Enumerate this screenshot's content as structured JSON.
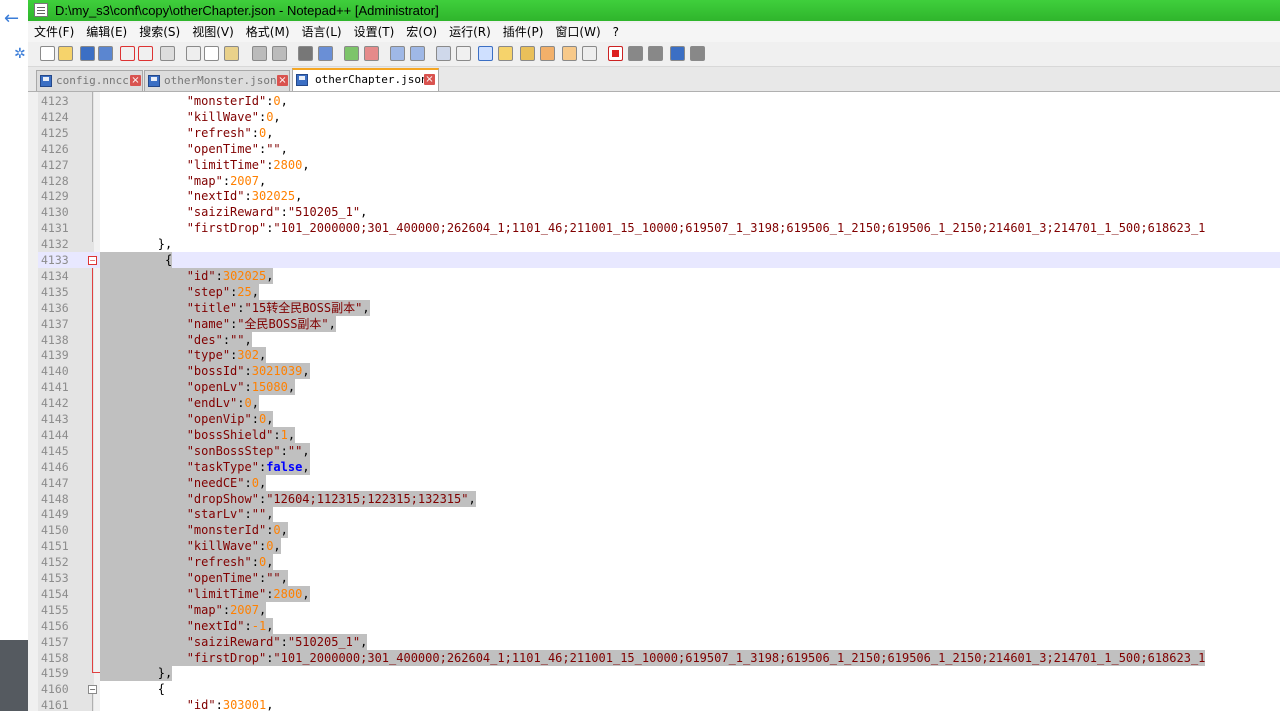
{
  "window": {
    "title": "D:\\my_s3\\conf\\copy\\otherChapter.json - Notepad++ [Administrator]"
  },
  "menu": [
    "文件(F)",
    "编辑(E)",
    "搜索(S)",
    "视图(V)",
    "格式(M)",
    "语言(L)",
    "设置(T)",
    "宏(O)",
    "运行(R)",
    "插件(P)",
    "窗口(W)",
    "?"
  ],
  "tabs": [
    {
      "label": "config.nncc",
      "active": false
    },
    {
      "label": "otherMonster.json",
      "active": false
    },
    {
      "label": "otherChapter.json",
      "active": true
    }
  ],
  "colors": {
    "titlebar": "#2fb52c",
    "selection": "#c0c0c0",
    "key": "#800000",
    "number": "#ff8000",
    "keyword": "#0000ff",
    "fold": "#e04040"
  },
  "lines": [
    {
      "num": "4123",
      "ind": "            ",
      "k": "\"monsterId\"",
      "v": "0",
      "t": "n",
      "end": ","
    },
    {
      "num": "4124",
      "ind": "            ",
      "k": "\"killWave\"",
      "v": "0",
      "t": "n",
      "end": ","
    },
    {
      "num": "4125",
      "ind": "            ",
      "k": "\"refresh\"",
      "v": "0",
      "t": "n",
      "end": ","
    },
    {
      "num": "4126",
      "ind": "            ",
      "k": "\"openTime\"",
      "v": "\"\"",
      "t": "s",
      "end": ","
    },
    {
      "num": "4127",
      "ind": "            ",
      "k": "\"limitTime\"",
      "v": "2800",
      "t": "n",
      "end": ","
    },
    {
      "num": "4128",
      "ind": "            ",
      "k": "\"map\"",
      "v": "2007",
      "t": "n",
      "end": ","
    },
    {
      "num": "4129",
      "ind": "            ",
      "k": "\"nextId\"",
      "v": "302025",
      "t": "n",
      "end": ","
    },
    {
      "num": "4130",
      "ind": "            ",
      "k": "\"saiziReward\"",
      "v": "\"510205_1\"",
      "t": "s",
      "end": ","
    },
    {
      "num": "4131",
      "ind": "            ",
      "k": "\"firstDrop\"",
      "v": "\"101_2000000;301_400000;262604_1;1101_46;211001_15_10000;619507_1_3198;619506_1_2150;619506_1_2150;214601_3;214701_1_500;618623_1",
      "t": "s",
      "end": ""
    },
    {
      "num": "4132",
      "ind": "        ",
      "raw": "},"
    },
    {
      "num": "4133",
      "ind": "         ",
      "raw": "{",
      "sel": true,
      "caret": true,
      "fold": "red"
    },
    {
      "num": "4134",
      "ind": "            ",
      "k": "\"id\"",
      "v": "302025",
      "t": "n",
      "end": ",",
      "sel": true
    },
    {
      "num": "4135",
      "ind": "            ",
      "k": "\"step\"",
      "v": "25",
      "t": "n",
      "end": ",",
      "sel": true
    },
    {
      "num": "4136",
      "ind": "            ",
      "k": "\"title\"",
      "v": "\"15转全民BOSS副本\"",
      "t": "s",
      "end": ",",
      "sel": true
    },
    {
      "num": "4137",
      "ind": "            ",
      "k": "\"name\"",
      "v": "\"全民BOSS副本\"",
      "t": "s",
      "end": ",",
      "sel": true
    },
    {
      "num": "4138",
      "ind": "            ",
      "k": "\"des\"",
      "v": "\"\"",
      "t": "s",
      "end": ",",
      "sel": true
    },
    {
      "num": "4139",
      "ind": "            ",
      "k": "\"type\"",
      "v": "302",
      "t": "n",
      "end": ",",
      "sel": true
    },
    {
      "num": "4140",
      "ind": "            ",
      "k": "\"bossId\"",
      "v": "3021039",
      "t": "n",
      "end": ",",
      "sel": true
    },
    {
      "num": "4141",
      "ind": "            ",
      "k": "\"openLv\"",
      "v": "15080",
      "t": "n",
      "end": ",",
      "sel": true
    },
    {
      "num": "4142",
      "ind": "            ",
      "k": "\"endLv\"",
      "v": "0",
      "t": "n",
      "end": ",",
      "sel": true
    },
    {
      "num": "4143",
      "ind": "            ",
      "k": "\"openVip\"",
      "v": "0",
      "t": "n",
      "end": ",",
      "sel": true
    },
    {
      "num": "4144",
      "ind": "            ",
      "k": "\"bossShield\"",
      "v": "1",
      "t": "n",
      "end": ",",
      "sel": true
    },
    {
      "num": "4145",
      "ind": "            ",
      "k": "\"sonBossStep\"",
      "v": "\"\"",
      "t": "s",
      "end": ",",
      "sel": true
    },
    {
      "num": "4146",
      "ind": "            ",
      "k": "\"taskType\"",
      "v": "false",
      "t": "b",
      "end": ",",
      "sel": true
    },
    {
      "num": "4147",
      "ind": "            ",
      "k": "\"needCE\"",
      "v": "0",
      "t": "n",
      "end": ",",
      "sel": true
    },
    {
      "num": "4148",
      "ind": "            ",
      "k": "\"dropShow\"",
      "v": "\"12604;112315;122315;132315\"",
      "t": "s",
      "end": ",",
      "sel": true
    },
    {
      "num": "4149",
      "ind": "            ",
      "k": "\"starLv\"",
      "v": "\"\"",
      "t": "s",
      "end": ",",
      "sel": true
    },
    {
      "num": "4150",
      "ind": "            ",
      "k": "\"monsterId\"",
      "v": "0",
      "t": "n",
      "end": ",",
      "sel": true
    },
    {
      "num": "4151",
      "ind": "            ",
      "k": "\"killWave\"",
      "v": "0",
      "t": "n",
      "end": ",",
      "sel": true
    },
    {
      "num": "4152",
      "ind": "            ",
      "k": "\"refresh\"",
      "v": "0",
      "t": "n",
      "end": ",",
      "sel": true
    },
    {
      "num": "4153",
      "ind": "            ",
      "k": "\"openTime\"",
      "v": "\"\"",
      "t": "s",
      "end": ",",
      "sel": true
    },
    {
      "num": "4154",
      "ind": "            ",
      "k": "\"limitTime\"",
      "v": "2800",
      "t": "n",
      "end": ",",
      "sel": true
    },
    {
      "num": "4155",
      "ind": "            ",
      "k": "\"map\"",
      "v": "2007",
      "t": "n",
      "end": ",",
      "sel": true
    },
    {
      "num": "4156",
      "ind": "            ",
      "k": "\"nextId\"",
      "v": "-1",
      "t": "n",
      "end": ",",
      "sel": true
    },
    {
      "num": "4157",
      "ind": "            ",
      "k": "\"saiziReward\"",
      "v": "\"510205_1\"",
      "t": "s",
      "end": ",",
      "sel": true
    },
    {
      "num": "4158",
      "ind": "            ",
      "k": "\"firstDrop\"",
      "v": "\"101_2000000;301_400000;262604_1;1101_46;211001_15_10000;619507_1_3198;619506_1_2150;619506_1_2150;214601_3;214701_1_500;618623_1",
      "t": "s",
      "end": "",
      "sel": true
    },
    {
      "num": "4159",
      "ind": "        ",
      "raw": "},",
      "sel": true
    },
    {
      "num": "4160",
      "ind": "        ",
      "raw": "{",
      "fold": "gray"
    },
    {
      "num": "4161",
      "ind": "            ",
      "k": "\"id\"",
      "v": "303001",
      "t": "n",
      "end": ","
    }
  ]
}
